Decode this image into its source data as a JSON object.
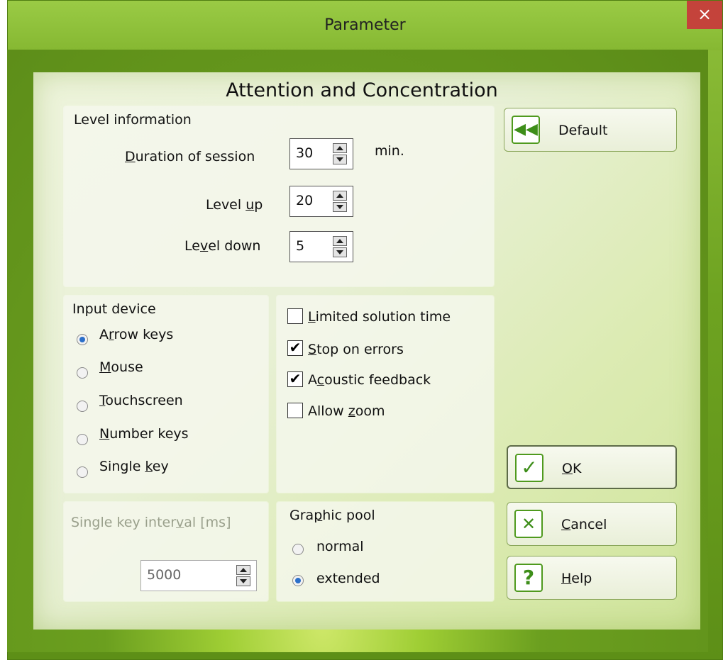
{
  "window": {
    "title": "Parameter",
    "close_label": "×"
  },
  "heading": "Attention and Concentration",
  "level_info": {
    "title": "Level information",
    "duration": {
      "label_pre": "",
      "label_u": "D",
      "label_post": "uration of session",
      "value": "30",
      "unit": "min."
    },
    "level_up": {
      "label_pre": "Level ",
      "label_u": "u",
      "label_post": "p",
      "value": "20"
    },
    "level_down": {
      "label_pre": "Le",
      "label_u": "v",
      "label_post": "el down",
      "value": "5"
    }
  },
  "input_device": {
    "title": "Input device",
    "options": [
      {
        "pre": "A",
        "u": "r",
        "post": "row keys",
        "selected": true
      },
      {
        "pre": "",
        "u": "M",
        "post": "ouse",
        "selected": false
      },
      {
        "pre": "",
        "u": "T",
        "post": "ouchscreen",
        "selected": false
      },
      {
        "pre": "",
        "u": "N",
        "post": "umber keys",
        "selected": false
      },
      {
        "pre": "Single ",
        "u": "k",
        "post": "ey",
        "selected": false
      }
    ]
  },
  "options": {
    "items": [
      {
        "pre": "",
        "u": "L",
        "post": "imited solution time",
        "checked": false
      },
      {
        "pre": "",
        "u": "S",
        "post": "top on errors",
        "checked": true
      },
      {
        "pre": "A",
        "u": "c",
        "post": "oustic feedback",
        "checked": true
      },
      {
        "pre": "Allow ",
        "u": "z",
        "post": "oom",
        "checked": false
      }
    ],
    "check_mark": "✔"
  },
  "single_key": {
    "pre": "Single key inter",
    "u": "v",
    "post": "al [ms]",
    "value": "5000"
  },
  "graphic_pool": {
    "title_pre": "Gra",
    "title_u": "p",
    "title_post": "hic pool",
    "options": [
      {
        "label": "normal",
        "selected": false
      },
      {
        "label": "extended",
        "selected": true
      }
    ]
  },
  "buttons": {
    "default": {
      "label": "Default",
      "icon": "rewind-icon",
      "glyph": "◀◀"
    },
    "ok": {
      "u": "O",
      "post": "K",
      "icon": "check-icon",
      "glyph": "✓"
    },
    "cancel": {
      "u": "C",
      "post": "ancel",
      "icon": "x-icon",
      "glyph": "✕"
    },
    "help": {
      "u": "H",
      "post": "elp",
      "icon": "question-icon",
      "glyph": "?"
    }
  }
}
